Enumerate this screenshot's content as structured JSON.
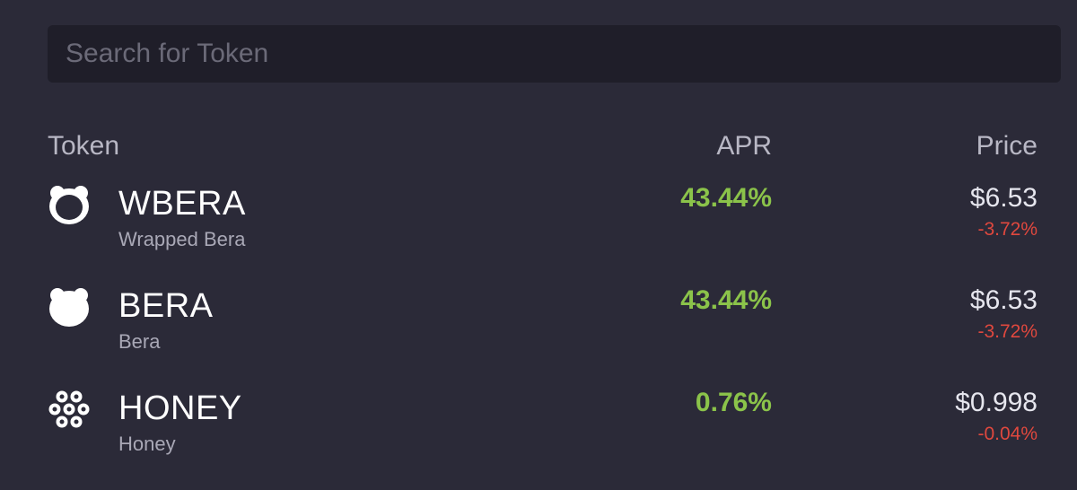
{
  "search": {
    "placeholder": "Search for Token",
    "value": ""
  },
  "table": {
    "headers": {
      "token": "Token",
      "apr": "APR",
      "price": "Price"
    },
    "rows": [
      {
        "icon": "bear-outline-icon",
        "symbol": "WBERA",
        "name": "Wrapped Bera",
        "apr": "43.44%",
        "price": "$6.53",
        "change": "-3.72%"
      },
      {
        "icon": "bear-solid-icon",
        "symbol": "BERA",
        "name": "Bera",
        "apr": "43.44%",
        "price": "$6.53",
        "change": "-3.72%"
      },
      {
        "icon": "honeycomb-icon",
        "symbol": "HONEY",
        "name": "Honey",
        "apr": "0.76%",
        "price": "$0.998",
        "change": "-0.04%"
      }
    ]
  },
  "colors": {
    "background": "#2b2a38",
    "search_background": "#1f1e29",
    "positive": "#8bc34a",
    "negative": "#e0483e"
  }
}
